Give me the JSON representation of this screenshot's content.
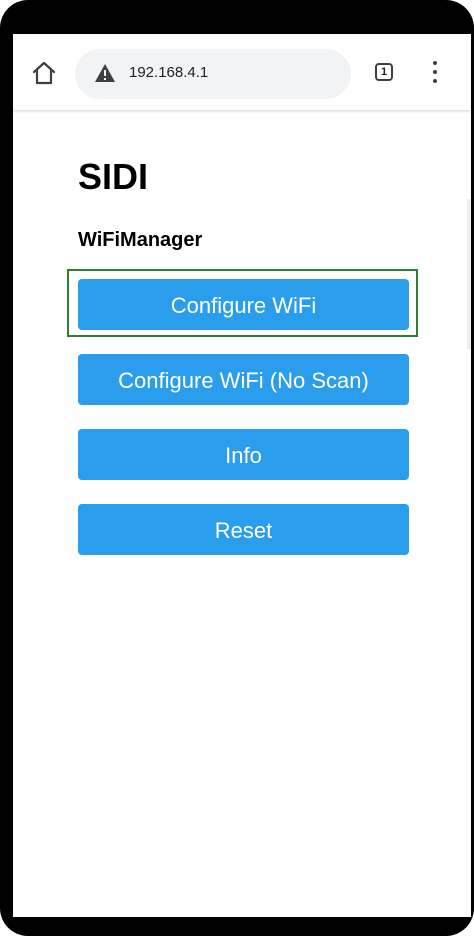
{
  "browser": {
    "url": "192.168.4.1",
    "tab_count": "1"
  },
  "page": {
    "title": "SIDI",
    "subtitle": "WiFiManager"
  },
  "buttons": {
    "configure_wifi": "Configure WiFi",
    "configure_wifi_noscan": "Configure WiFi (No Scan)",
    "info": "Info",
    "reset": "Reset"
  },
  "colors": {
    "button_bg": "#2b9ded",
    "button_text": "#ffffff",
    "focus_ring": "#2e7d32",
    "urlbar_bg": "#f1f3f4"
  },
  "icons": {
    "home": "home-icon",
    "warning": "warning-icon",
    "tabs": "tabs-icon",
    "menu": "more-vert-icon"
  }
}
